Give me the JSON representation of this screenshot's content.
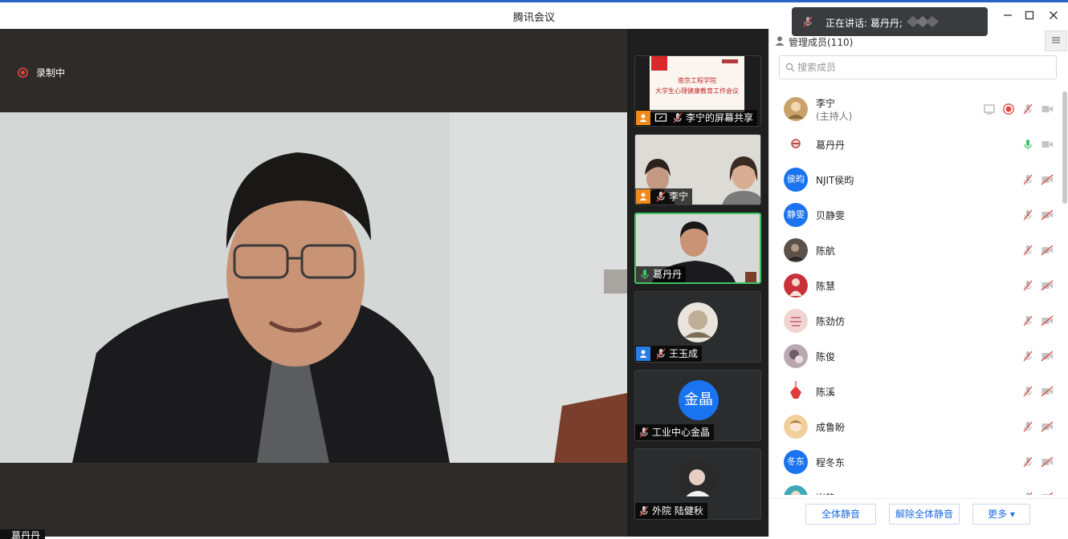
{
  "window": {
    "title": "腾讯会议"
  },
  "speaking": {
    "text": "正在讲话: 葛丹丹;"
  },
  "recording": {
    "label": "录制中"
  },
  "main_video": {
    "speaker_name": "葛丹丹"
  },
  "thumbnails": [
    {
      "name": "李宁的屏幕共享",
      "kind": "screen-share",
      "slide_lines": [
        "南京工程学院",
        "大学生心理健康教育工作会议"
      ]
    },
    {
      "name": "李宁",
      "kind": "camera"
    },
    {
      "name": "葛丹丹",
      "kind": "camera",
      "active": true
    },
    {
      "name": "王玉成",
      "kind": "photo-avatar"
    },
    {
      "name": "工业中心金晶",
      "kind": "text-avatar",
      "avatar_text": "金晶"
    },
    {
      "name": "外院 陆健秋",
      "kind": "photo-avatar"
    }
  ],
  "panel": {
    "header": "管理成员(110)",
    "search_placeholder": "搜索成员",
    "members": [
      {
        "name": "李宁",
        "role": "(主持人)",
        "avatar": "photo",
        "avatar_color": "#c9a26a",
        "mic": "muted",
        "extras": [
          "screen-icon",
          "record-icon"
        ]
      },
      {
        "name": "葛丹丹",
        "avatar": "photo",
        "avatar_color": "#e7e0dc",
        "mic": "active"
      },
      {
        "name": "NJIT侯昀",
        "avatar": "text",
        "avatar_text": "侯昀",
        "mic": "muted"
      },
      {
        "name": "贝静雯",
        "avatar": "text",
        "avatar_text": "静雯",
        "mic": "muted"
      },
      {
        "name": "陈航",
        "avatar": "photo",
        "avatar_color": "#5b5148",
        "mic": "muted"
      },
      {
        "name": "陈慧",
        "avatar": "photo",
        "avatar_color": "#c8303a",
        "mic": "muted"
      },
      {
        "name": "陈劲仿",
        "avatar": "photo",
        "avatar_color": "#f0d4d0",
        "mic": "muted"
      },
      {
        "name": "陈俊",
        "avatar": "photo",
        "avatar_color": "#b9a8b0",
        "mic": "muted"
      },
      {
        "name": "陈溪",
        "avatar": "photo",
        "avatar_color": "#e03a3a",
        "mic": "muted"
      },
      {
        "name": "成鲁盼",
        "avatar": "photo",
        "avatar_color": "#f1cf9a",
        "mic": "muted"
      },
      {
        "name": "程冬东",
        "avatar": "text",
        "avatar_text": "冬东",
        "mic": "muted"
      },
      {
        "name": "崔静",
        "avatar": "photo",
        "avatar_color": "#3fa9b8",
        "mic": "muted"
      }
    ]
  },
  "footer": {
    "mute_all": "全体静音",
    "unmute_all": "解除全体静音",
    "more": "更多 ▾"
  },
  "colors": {
    "accent": "#1f6fe0",
    "active_border": "#3cc565",
    "record": "#e04840",
    "avatar_blue": "#1a73f0"
  }
}
